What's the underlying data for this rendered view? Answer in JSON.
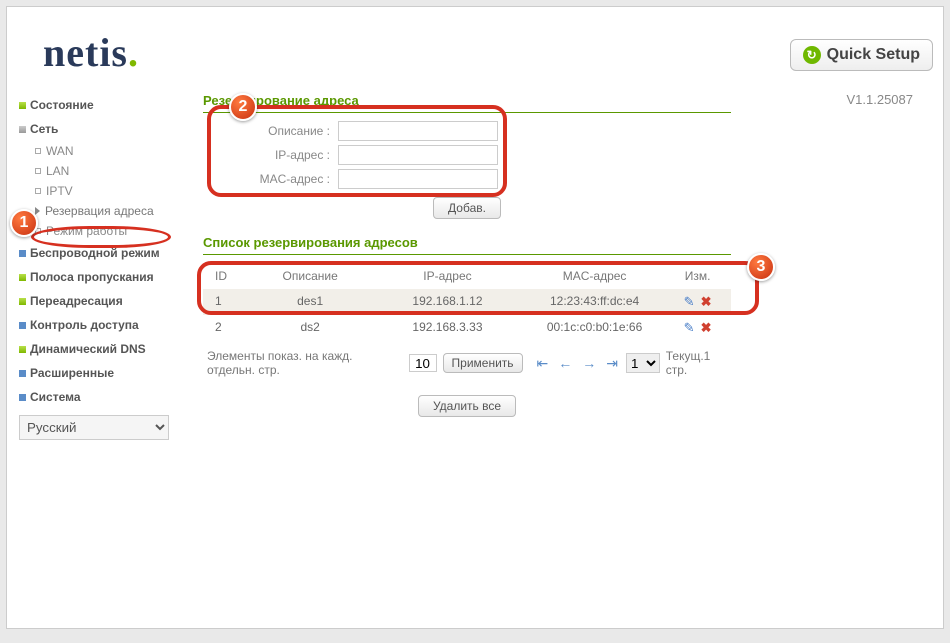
{
  "header": {
    "logo": "netis",
    "quick_setup": "Quick Setup",
    "version": "V1.1.25087"
  },
  "sidebar": {
    "items": [
      {
        "label": "Состояние",
        "bold": true,
        "color": "green"
      },
      {
        "label": "Сеть",
        "bold": true,
        "color": "gray",
        "subs": [
          {
            "label": "WAN"
          },
          {
            "label": "LAN"
          },
          {
            "label": "IPTV"
          },
          {
            "label": "Резервация адреса",
            "active": true
          },
          {
            "label": "Режим работы"
          }
        ]
      },
      {
        "label": "Беспроводной режим",
        "bold": true,
        "color": "blue"
      },
      {
        "label": "Полоса пропускания",
        "bold": true,
        "color": "green"
      },
      {
        "label": "Переадресация",
        "bold": true,
        "color": "green"
      },
      {
        "label": "Контроль доступа",
        "bold": true,
        "color": "blue"
      },
      {
        "label": "Динамический DNS",
        "bold": true,
        "color": "green"
      },
      {
        "label": "Расширенные",
        "bold": true,
        "color": "blue"
      },
      {
        "label": "Система",
        "bold": true,
        "color": "blue"
      }
    ],
    "lang": "Русский"
  },
  "content": {
    "section1": {
      "title": "Резервирование адреса",
      "fields": {
        "desc": "Описание :",
        "ip": "IP-адрес :",
        "mac": "MAC-адрес :"
      },
      "add_btn": "Добав."
    },
    "section2": {
      "title": "Список резервирования адресов",
      "headers": {
        "id": "ID",
        "desc": "Описание",
        "ip": "IP-адрес",
        "mac": "MAC-адрес",
        "act": "Изм."
      },
      "rows": [
        {
          "id": "1",
          "desc": "des1",
          "ip": "192.168.1.12",
          "mac": "12:23:43:ff:dc:e4"
        },
        {
          "id": "2",
          "desc": "ds2",
          "ip": "192.168.3.33",
          "mac": "00:1c:c0:b0:1e:66"
        }
      ],
      "pager": {
        "per_page_label": "Элементы показ. на кажд. отдельн. стр.",
        "per_page_value": "10",
        "apply": "Применить",
        "page_value": "1",
        "current": "Текущ.1 стр."
      },
      "delete_all": "Удалить все"
    }
  }
}
